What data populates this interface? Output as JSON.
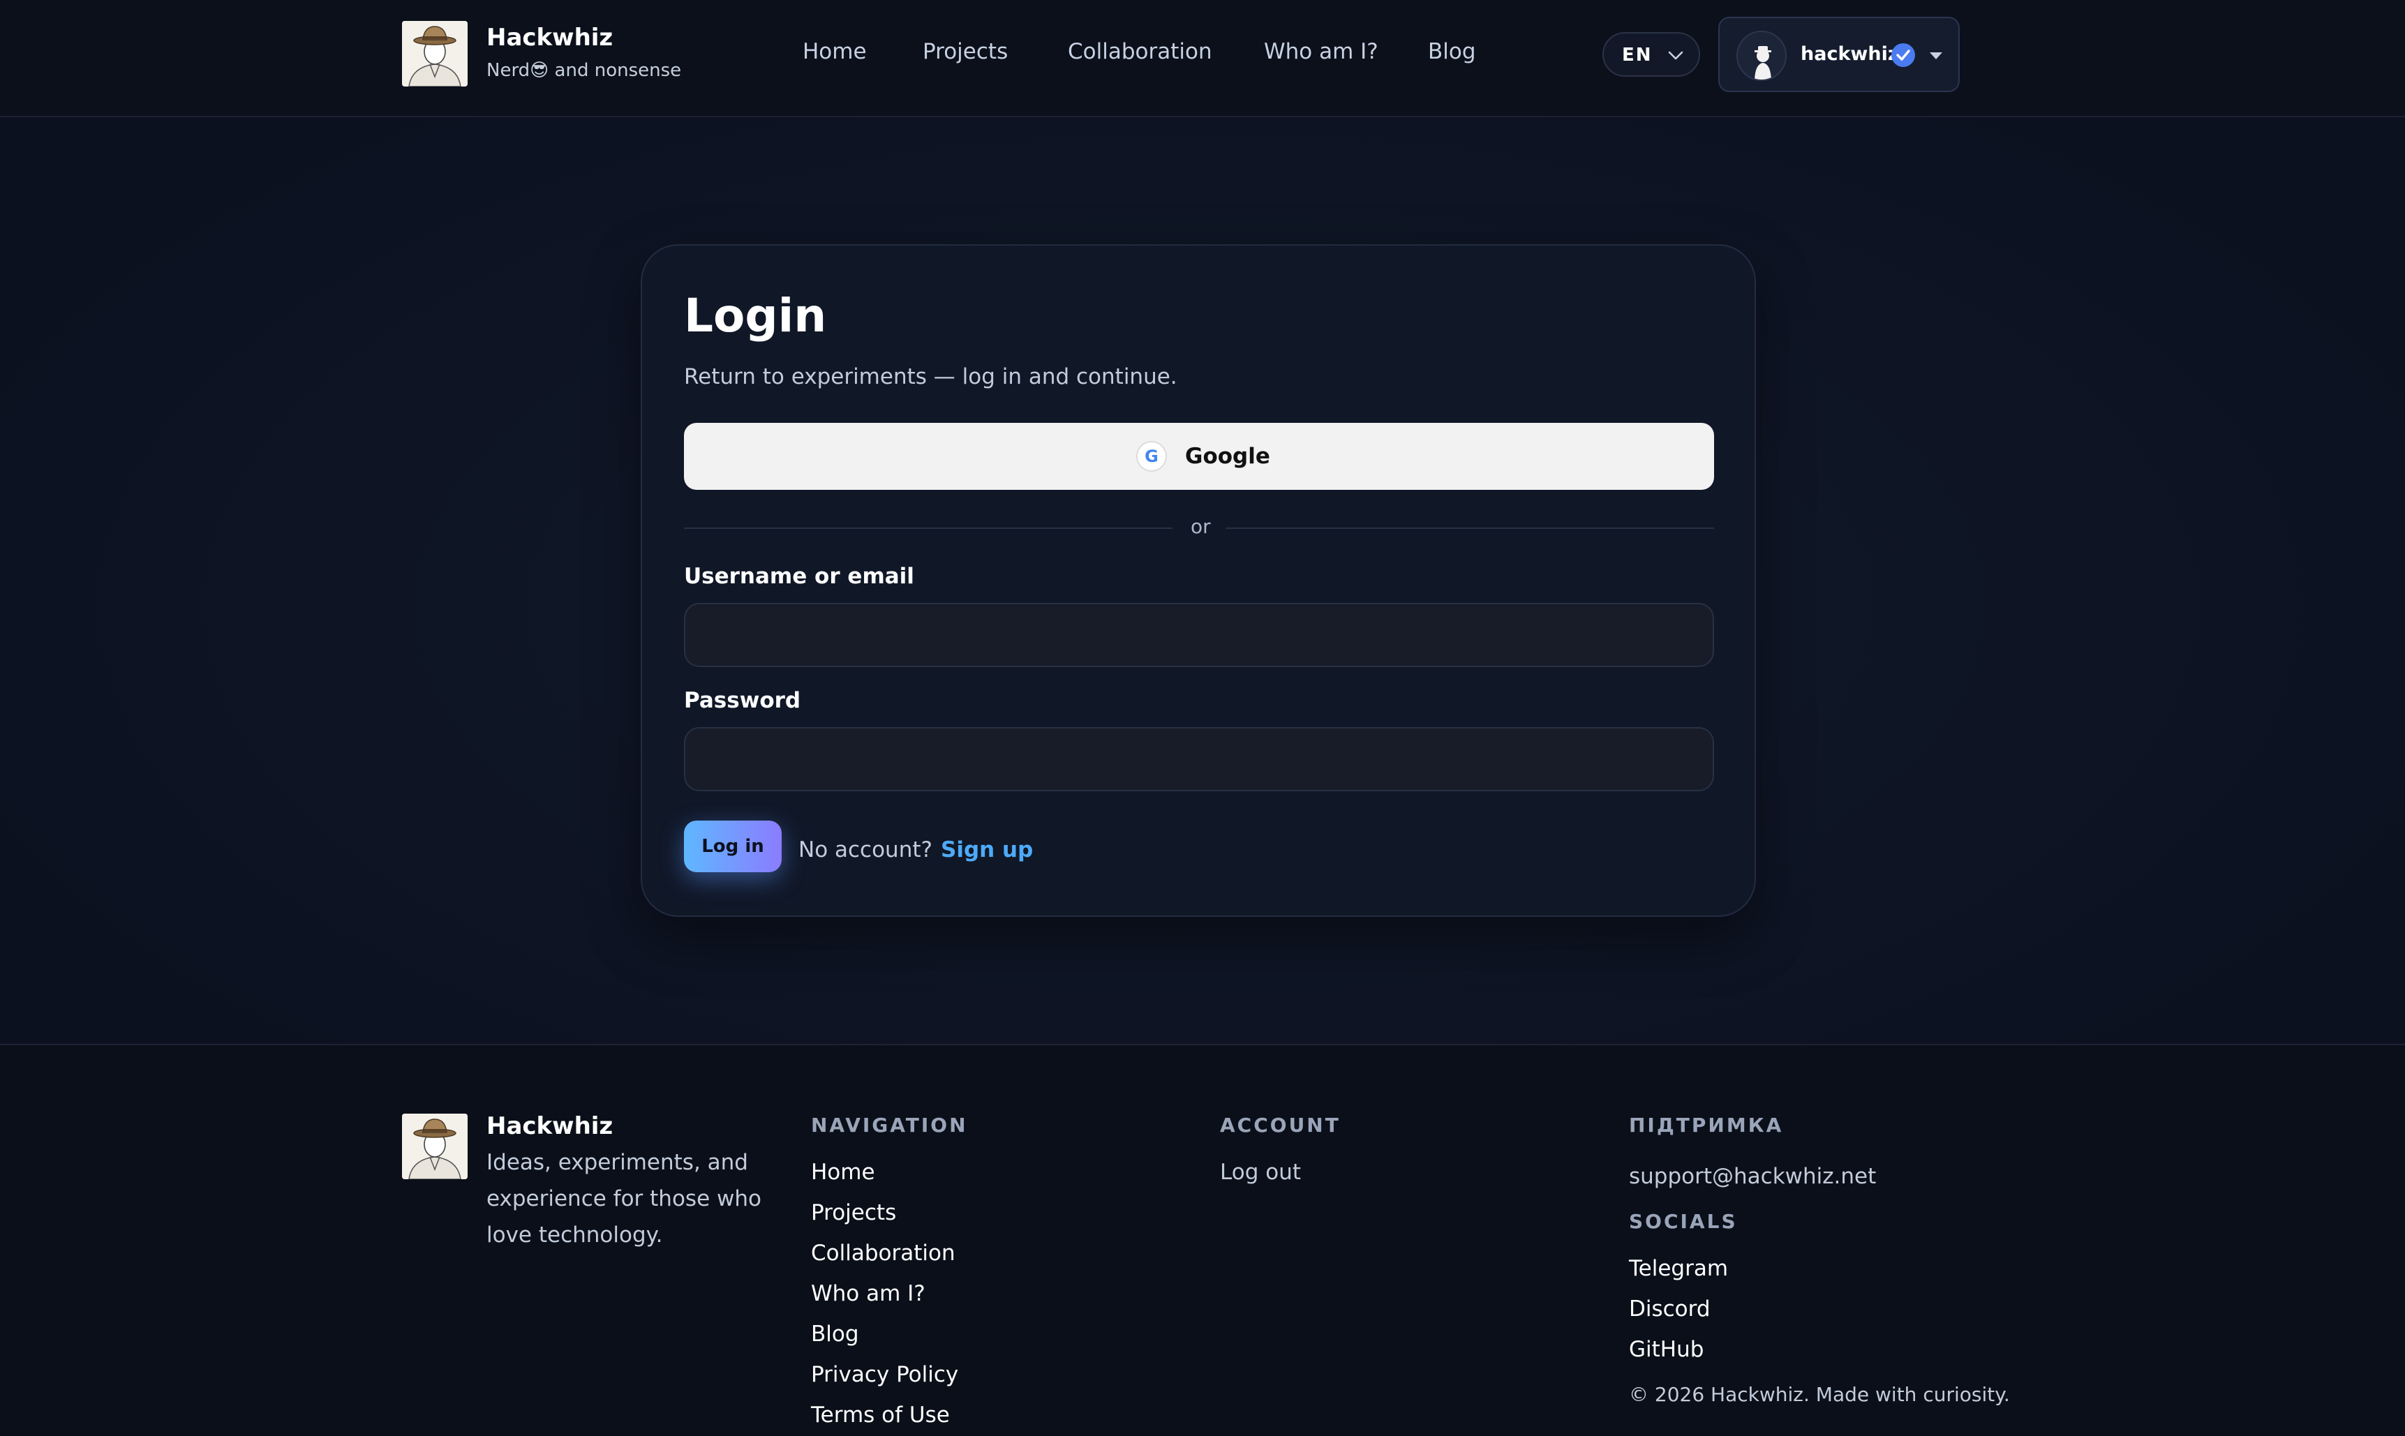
{
  "header": {
    "brand_name": "Hackwhiz",
    "brand_tagline": "Nerd😎 and nonsense",
    "nav": [
      {
        "label": "Home"
      },
      {
        "label": "Projects"
      },
      {
        "label": "Collaboration"
      },
      {
        "label": "Who am I?"
      },
      {
        "label": "Blog"
      }
    ],
    "language": "EN",
    "user": {
      "name": "hackwhiz",
      "verified": true
    }
  },
  "login": {
    "title": "Login",
    "subtitle": "Return to experiments — log in and continue.",
    "google_label": "Google",
    "google_icon_letter": "G",
    "divider": "or",
    "username_label": "Username or email",
    "username_value": "",
    "password_label": "Password",
    "password_value": "",
    "submit_label": "Log in",
    "no_account_text": "No account?",
    "signup_label": "Sign up"
  },
  "footer": {
    "brand_name": "Hackwhiz",
    "description": "Ideas, experiments, and experience for those who love technology.",
    "navigation_heading": "NAVIGATION",
    "navigation_links": [
      {
        "label": "Home"
      },
      {
        "label": "Projects"
      },
      {
        "label": "Collaboration"
      },
      {
        "label": "Who am I?"
      },
      {
        "label": "Blog"
      },
      {
        "label": "Privacy Policy"
      },
      {
        "label": "Terms of Use"
      }
    ],
    "account_heading": "ACCOUNT",
    "account_links": [
      {
        "label": "Log out"
      }
    ],
    "support_heading": "ПІДТРИМКА",
    "support_email": "support@hackwhiz.net",
    "socials_heading": "SOCIALS",
    "social_links": [
      {
        "label": "Telegram"
      },
      {
        "label": "Discord"
      },
      {
        "label": "GitHub"
      }
    ],
    "copyright": "© 2026 Hackwhiz. Made with curiosity."
  },
  "colors": {
    "background": "#0d1220",
    "accent_link": "#4eaaf7",
    "button_gradient_start": "#5fb7ff",
    "button_gradient_end": "#8b7cff"
  }
}
